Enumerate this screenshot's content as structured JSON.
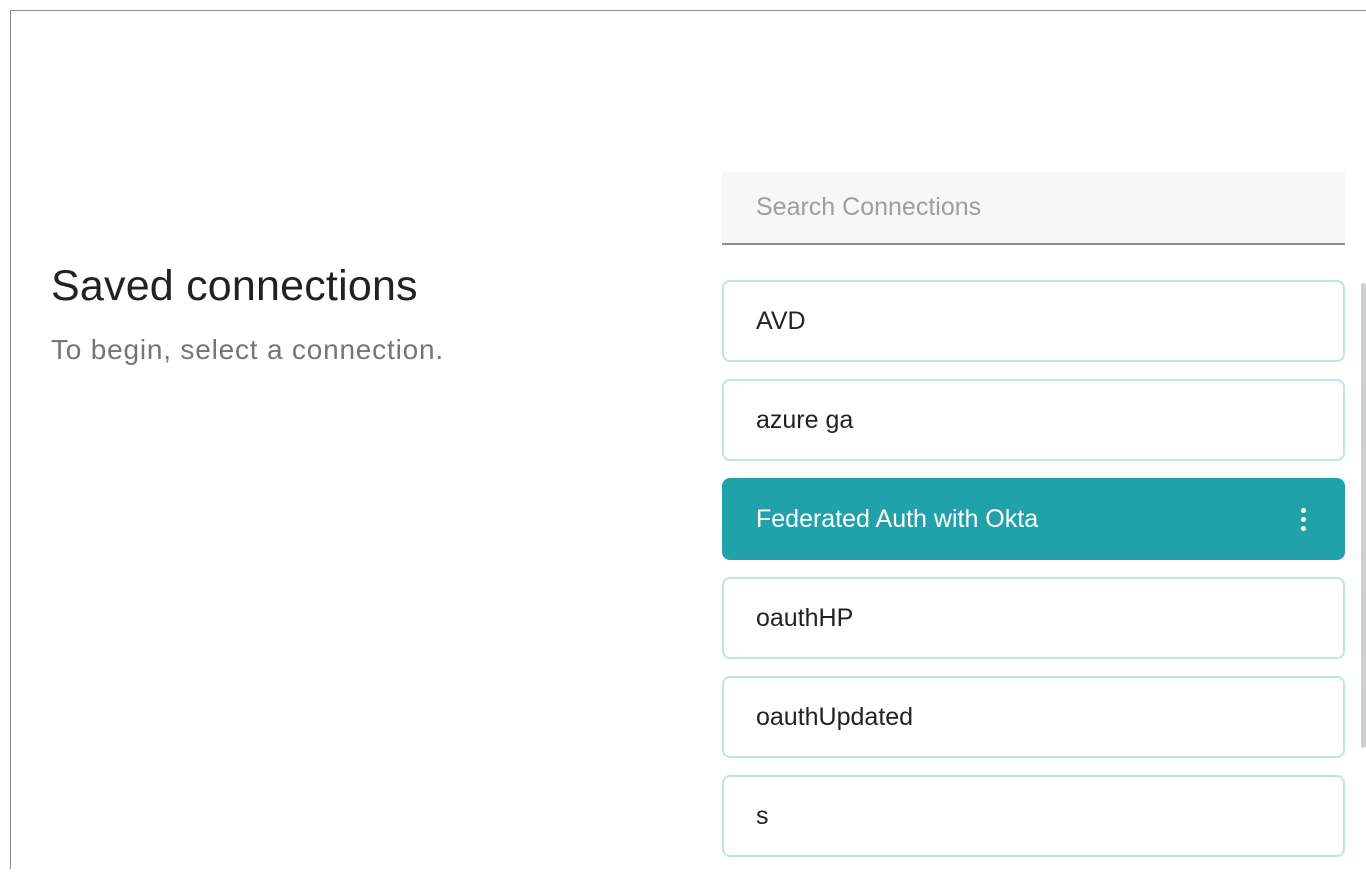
{
  "header": {
    "title": "Saved connections",
    "subtitle": "To begin, select a connection."
  },
  "search": {
    "placeholder": "Search Connections",
    "value": ""
  },
  "connections": [
    {
      "label": "AVD",
      "selected": false
    },
    {
      "label": "azure ga",
      "selected": false
    },
    {
      "label": "Federated Auth with Okta",
      "selected": true
    },
    {
      "label": "oauthHP",
      "selected": false
    },
    {
      "label": "oauthUpdated",
      "selected": false
    },
    {
      "label": "s",
      "selected": false
    }
  ],
  "icons": {
    "selected_item_menu": "more-vertical-icon"
  },
  "colors": {
    "accent": "#21a2ab",
    "item_border": "#bde3ef",
    "subtitle_text": "#757575"
  }
}
